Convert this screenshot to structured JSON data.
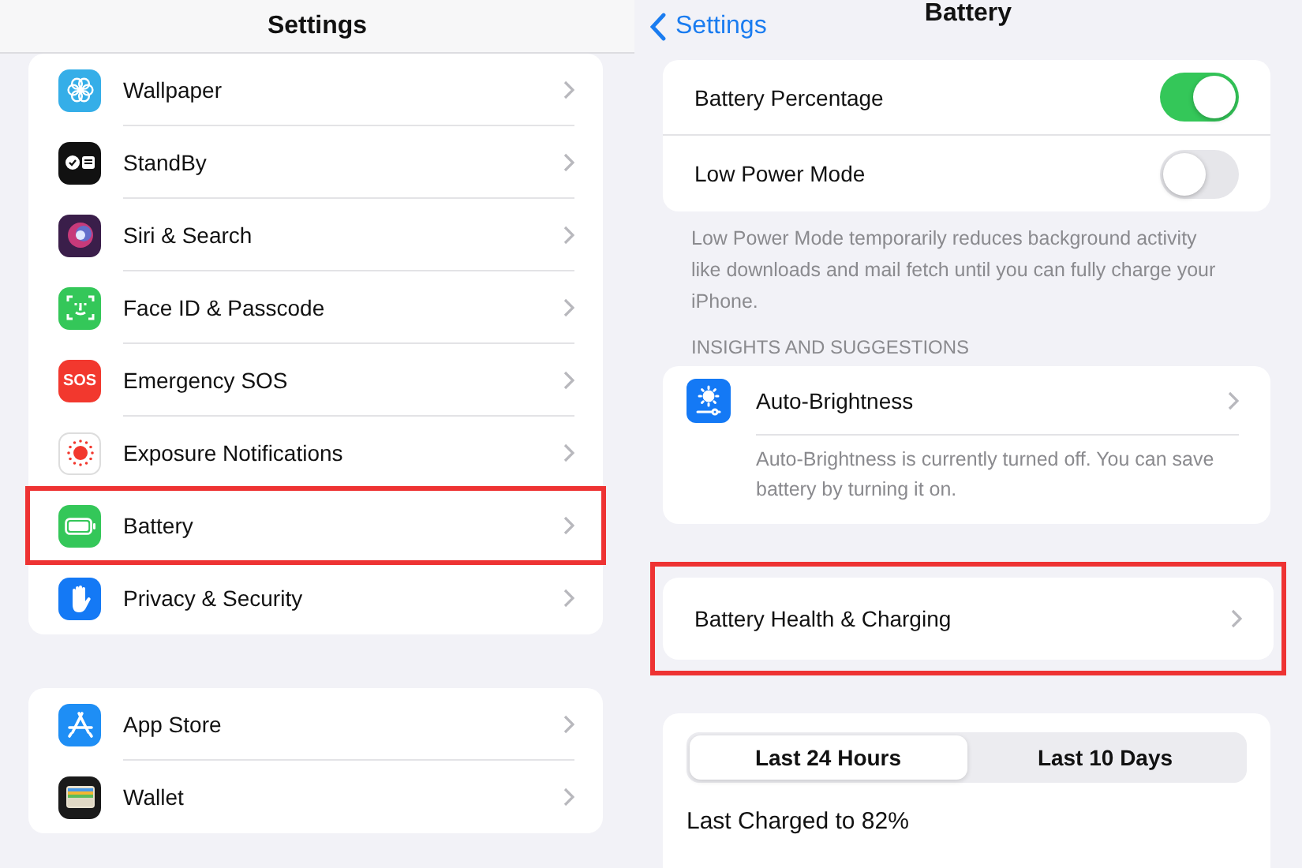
{
  "settings_pane": {
    "title": "Settings",
    "groups": [
      {
        "items": [
          {
            "label": "Wallpaper",
            "color": "#35aee8",
            "highlighted": false
          },
          {
            "label": "StandBy",
            "color": "#111111",
            "highlighted": false
          },
          {
            "label": "Siri & Search",
            "color": "#3a1e4a",
            "highlighted": false
          },
          {
            "label": "Face ID & Passcode",
            "color": "#34c759",
            "highlighted": false
          },
          {
            "label": "Emergency SOS",
            "color": "#f2382e",
            "highlighted": false,
            "icon_text": "SOS"
          },
          {
            "label": "Exposure Notifications",
            "color": "#ffffff",
            "highlighted": false
          },
          {
            "label": "Battery",
            "color": "#34c759",
            "highlighted": true
          },
          {
            "label": "Privacy & Security",
            "color": "#1479f5",
            "highlighted": false
          }
        ]
      },
      {
        "items": [
          {
            "label": "App Store",
            "color": "#1e8ef5",
            "highlighted": false
          },
          {
            "label": "Wallet",
            "color": "#1a1a1a",
            "highlighted": false
          }
        ]
      }
    ]
  },
  "battery_pane": {
    "back": "Settings",
    "title": "Battery",
    "toggles": [
      {
        "label": "Battery Percentage",
        "on": true
      },
      {
        "label": "Low Power Mode",
        "on": false
      }
    ],
    "toggles_footer": "Low Power Mode temporarily reduces background activity like downloads and mail fetch until you can fully charge your iPhone.",
    "section_header": "INSIGHTS AND SUGGESTIONS",
    "insight": {
      "label": "Auto-Brightness",
      "description": "Auto-Brightness is currently turned off. You can save battery by turning it on."
    },
    "health_row": {
      "label": "Battery Health & Charging",
      "highlighted": true
    },
    "segments": [
      {
        "label": "Last 24 Hours",
        "selected": true
      },
      {
        "label": "Last 10 Days",
        "selected": false
      }
    ],
    "last_charged": "Last Charged to 82%"
  }
}
